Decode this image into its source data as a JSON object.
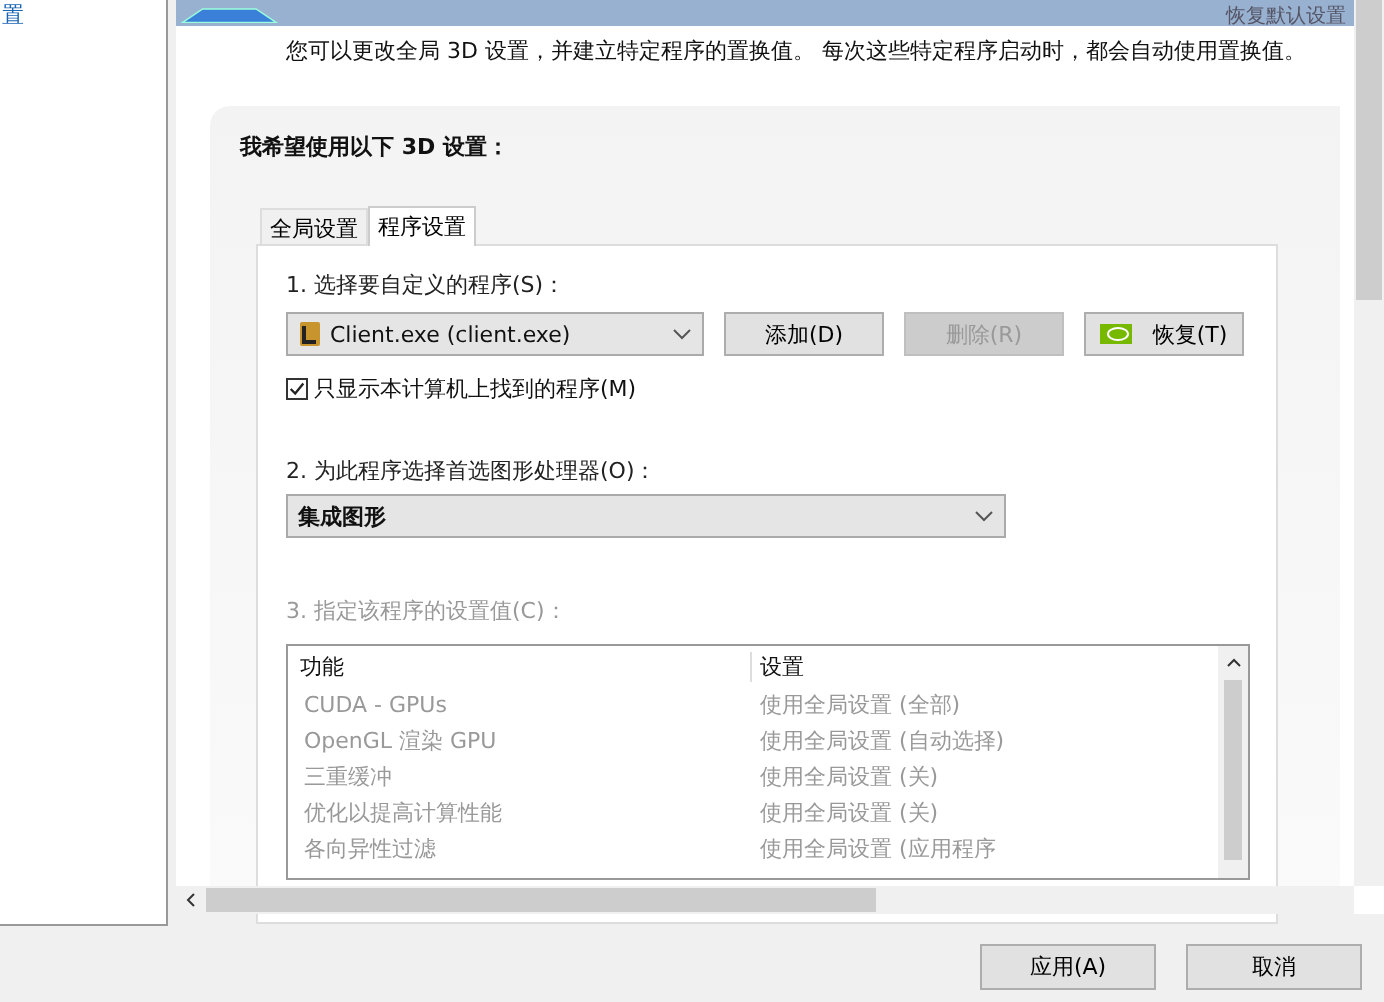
{
  "sidebar": {
    "link": "置"
  },
  "header": {
    "restore_link": "恢复默认设置"
  },
  "description": "您可以更改全局 3D 设置，并建立特定程序的置换值。 每次这些特定程序启动时，都会自动使用置换值。",
  "group": {
    "title": "我希望使用以下 3D 设置：",
    "tabs": [
      {
        "label": "全局设置",
        "selected": false
      },
      {
        "label": "程序设置",
        "selected": true
      }
    ],
    "program_label": "1. 选择要自定义的程序(S)：",
    "program_select": "Client.exe (client.exe)",
    "buttons": [
      {
        "label": "添加(D)",
        "disabled": false,
        "kind": "plain"
      },
      {
        "label": "删除(R)",
        "disabled": true,
        "kind": "plain"
      },
      {
        "label": "恢复(T)",
        "disabled": false,
        "kind": "logo"
      }
    ],
    "checkbox": {
      "label": "只显示本计算机上找到的程序(M)",
      "checked": true
    },
    "gpu_label": "2. 为此程序选择首选图形处理器(O)：",
    "gpu_select": "集成图形",
    "settings": {
      "label": "3. 指定该程序的设置值(C)：",
      "disabled": true,
      "columns": [
        "功能",
        "设置"
      ],
      "rows": [
        {
          "feature": "CUDA - GPUs",
          "value": "使用全局设置 (全部)"
        },
        {
          "feature": "OpenGL 渲染 GPU",
          "value": "使用全局设置 (自动选择)"
        },
        {
          "feature": "三重缓冲",
          "value": "使用全局设置 (关)"
        },
        {
          "feature": "优化以提高计算性能",
          "value": "使用全局设置 (关)"
        },
        {
          "feature": "各向异性过滤",
          "value": "使用全局设置 (应用程序"
        }
      ]
    }
  },
  "footer": {
    "buttons": [
      "应用(A)",
      "取消"
    ]
  }
}
